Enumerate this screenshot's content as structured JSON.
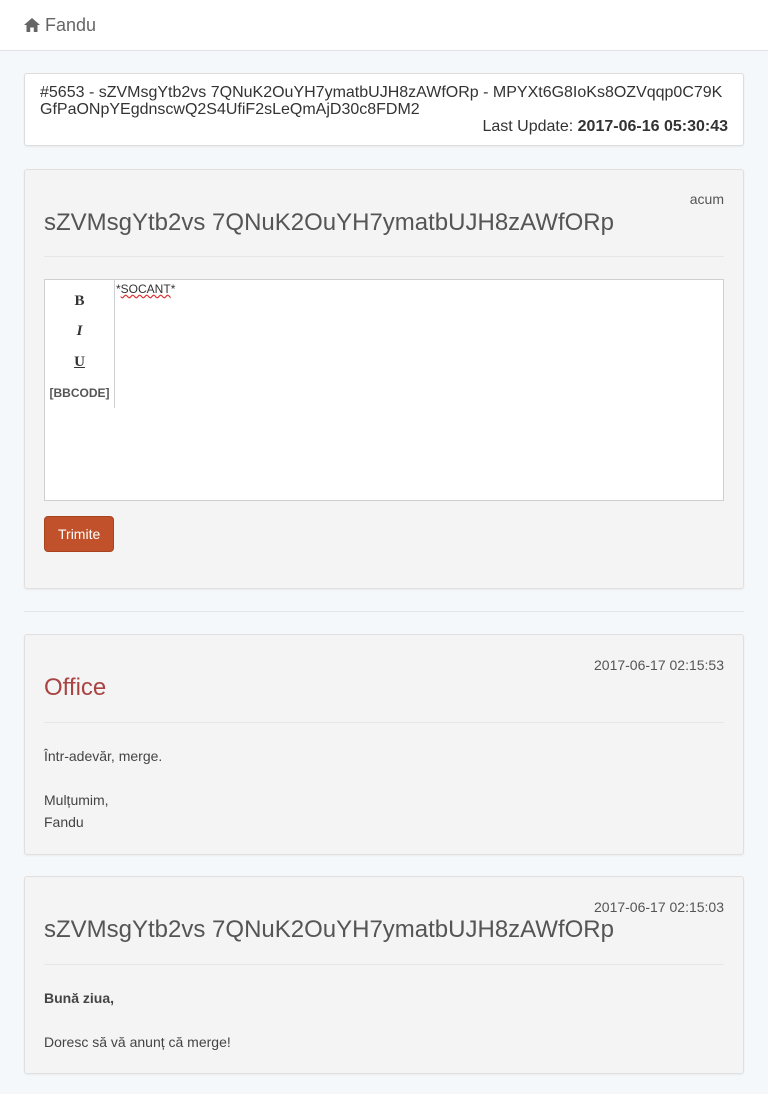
{
  "nav": {
    "brand": "Fandu"
  },
  "ticket": {
    "id_subject": "#5653 - sZVMsgYtb2vs 7QNuK2OuYH7ymatbUJH8zAWfORp - MPYXt6G8IoKs8OZVqqp0C79KGfPaONpYEgdnscwQ2S4UfiF2sLeQmAjD30c8FDM2",
    "last_update_label": "Last Update:",
    "last_update_value": "2017-06-16 05:30:43"
  },
  "reply": {
    "stamp": "acum",
    "author": "sZVMsgYtb2vs 7QNuK2OuYH7ymatbUJH8zAWfORp",
    "toolbar": {
      "bold": "B",
      "italic": "I",
      "underline": "U",
      "bbcode": "[BBCODE]"
    },
    "content_prefix": "*",
    "content_word": "SOCANT",
    "content_suffix": "*",
    "submit_label": "Trimite"
  },
  "messages": [
    {
      "timestamp": "2017-06-17 02:15:53",
      "author": "Office",
      "line1": " Într-adevăr, merge.",
      "line2": "Mulțumim,",
      "line3": "Fandu"
    },
    {
      "timestamp": "2017-06-17 02:15:03",
      "author": "sZVMsgYtb2vs 7QNuK2OuYH7ymatbUJH8zAWfORp",
      "line1": "Bună ziua,",
      "line2": "Doresc să vă anunț că merge!"
    }
  ],
  "colors": {
    "accent": "#c0512b",
    "staff_name": "#a94442"
  },
  "icons": {
    "brand": "home-icon"
  }
}
